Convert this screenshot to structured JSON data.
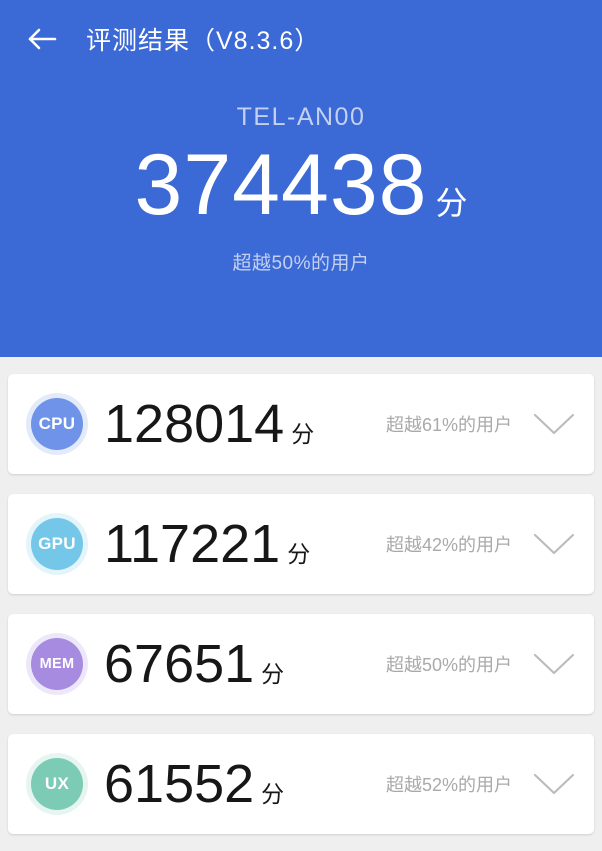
{
  "header": {
    "back_icon": "arrow-left-icon",
    "title": "评测结果（V8.3.6）"
  },
  "hero": {
    "device_name": "TEL-AN00",
    "total_score": "374438",
    "score_unit": "分",
    "rank_text": "超越50%的用户",
    "background_color": "#3b69d6",
    "muted_text_color": "#c3d0f0"
  },
  "cards": [
    {
      "badge_label": "CPU",
      "badge_color": "#6f93e8",
      "badge_halo_color": "#aec3f2",
      "score": "128014",
      "unit": "分",
      "rank_text": "超越61%的用户",
      "expand_icon": "chevron-down-icon"
    },
    {
      "badge_label": "GPU",
      "badge_color": "#74c7e8",
      "badge_halo_color": "#b3e0f3",
      "score": "117221",
      "unit": "分",
      "rank_text": "超越42%的用户",
      "expand_icon": "chevron-down-icon"
    },
    {
      "badge_label": "MEM",
      "badge_color": "#a78be0",
      "badge_halo_color": "#cbbced",
      "score": "67651",
      "unit": "分",
      "rank_text": "超越50%的用户",
      "expand_icon": "chevron-down-icon"
    },
    {
      "badge_label": "UX",
      "badge_color": "#7ccbb4",
      "badge_halo_color": "#b6e2d5",
      "score": "61552",
      "unit": "分",
      "rank_text": "超越52%的用户",
      "expand_icon": "chevron-down-icon"
    }
  ]
}
